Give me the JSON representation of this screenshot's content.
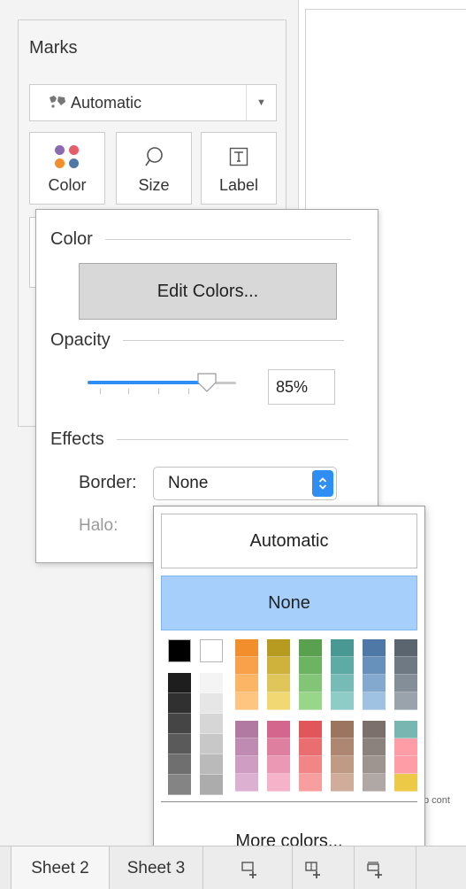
{
  "marks": {
    "title": "Marks",
    "mark_type": {
      "icon": "map-icon",
      "value": "Automatic"
    },
    "buttons": [
      {
        "label": "Color",
        "icon": "color-dots-icon"
      },
      {
        "label": "Size",
        "icon": "size-icon"
      },
      {
        "label": "Label",
        "icon": "label-icon"
      }
    ],
    "dot_colors": [
      "#8b6bb0",
      "#e35d6a",
      "#f28e2b",
      "#4e79a7"
    ]
  },
  "color_popup": {
    "color_header": "Color",
    "edit_colors_label": "Edit Colors...",
    "opacity_header": "Opacity",
    "opacity_value": "85%",
    "opacity_fraction": 0.85,
    "effects_header": "Effects",
    "border_label": "Border:",
    "border_value": "None",
    "halo_label": "Halo:"
  },
  "border_dropdown": {
    "automatic_label": "Automatic",
    "none_label": "None",
    "more_colors_label": "More colors...",
    "grayscale_columns": [
      {
        "top": "#000000",
        "ramp": [
          "#1e1e1e",
          "#303030",
          "#454545",
          "#5a5a5a",
          "#6f6f6f",
          "#848484"
        ]
      },
      {
        "top": "#ffffff",
        "ramp": [
          "#f4f4f4",
          "#e6e6e6",
          "#d6d6d6",
          "#c8c8c8",
          "#bababa",
          "#acacac"
        ]
      }
    ],
    "top_palette": [
      [
        "#f28e2b",
        "#f9a04a",
        "#fbb565",
        "#fdc57f"
      ],
      [
        "#b79a20",
        "#cfb23c",
        "#e0c65a",
        "#f1d872"
      ],
      [
        "#59a14f",
        "#6cb462",
        "#82c576",
        "#98d68a"
      ],
      [
        "#499894",
        "#5eaaa5",
        "#77bbb6",
        "#90ccc7"
      ],
      [
        "#4e79a7",
        "#6791bb",
        "#84a9cf",
        "#a0c2e2"
      ],
      [
        "#5a6570",
        "#6e7984",
        "#848e98",
        "#9aa3ac"
      ]
    ],
    "bottom_palette": [
      [
        "#b07aa1",
        "#c08bb2",
        "#cf9dc2",
        "#dcb0d1"
      ],
      [
        "#d4668e",
        "#df7fa0",
        "#eb98b4",
        "#f5b2c8"
      ],
      [
        "#e15759",
        "#ea6e70",
        "#f28687",
        "#f99e9f"
      ],
      [
        "#9c755f",
        "#ad8771",
        "#bf9a85",
        "#d0ad9a"
      ],
      [
        "#7b706b",
        "#8c827d",
        "#9e9590",
        "#b0a8a4"
      ],
      [
        "#76b7b2",
        "#ff9da7",
        "#ff9da7",
        "#edc948"
      ]
    ]
  },
  "canvas": {
    "partial_text": "p cont"
  },
  "tabs": [
    {
      "label": "Sheet 2"
    },
    {
      "label": "Sheet 3"
    }
  ],
  "tab_icons": [
    "new-worksheet-icon",
    "new-dashboard-icon",
    "new-story-icon"
  ]
}
